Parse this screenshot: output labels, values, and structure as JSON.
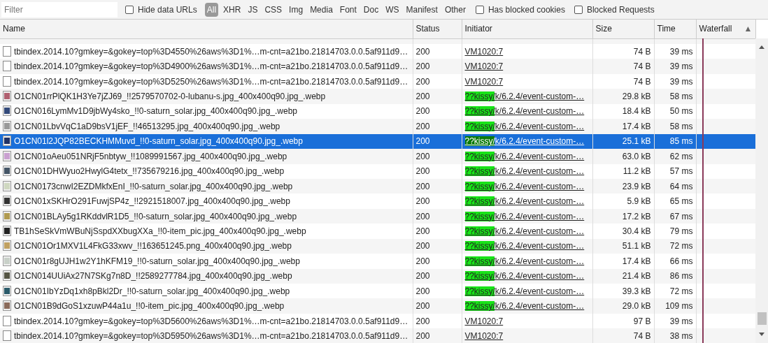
{
  "toolbar": {
    "filter": {
      "placeholder": "Filter"
    },
    "checkboxes_left": [
      {
        "label": "Hide data URLs",
        "checked": false
      }
    ],
    "types": [
      {
        "label": "All",
        "selected": true
      },
      {
        "label": "XHR",
        "selected": false
      },
      {
        "label": "JS",
        "selected": false
      },
      {
        "label": "CSS",
        "selected": false
      },
      {
        "label": "Img",
        "selected": false
      },
      {
        "label": "Media",
        "selected": false
      },
      {
        "label": "Font",
        "selected": false
      },
      {
        "label": "Doc",
        "selected": false
      },
      {
        "label": "WS",
        "selected": false
      },
      {
        "label": "Manifest",
        "selected": false
      },
      {
        "label": "Other",
        "selected": false
      }
    ],
    "checkboxes_right": [
      {
        "label": "Has blocked cookies",
        "checked": false
      },
      {
        "label": "Blocked Requests",
        "checked": false
      }
    ]
  },
  "table": {
    "columns": [
      "Name",
      "Status",
      "Initiator",
      "Size",
      "Time",
      "Waterfall"
    ],
    "sort_indicator": "▲",
    "rows": [
      {
        "kind": "doc",
        "name": "tbindex.2014.10?gmkey=&gokey=top%3D4550%26aws%3D1%…m-cnt=a21bo.21814703.0.0.5af911d9…",
        "status": "200",
        "initiator": "VM1020:7",
        "highlighted": false,
        "size": "74 B",
        "time": "39 ms",
        "selected": false
      },
      {
        "kind": "doc",
        "name": "tbindex.2014.10?gmkey=&gokey=top%3D4900%26aws%3D1%…m-cnt=a21bo.21814703.0.0.5af911d9…",
        "status": "200",
        "initiator": "VM1020:7",
        "highlighted": false,
        "size": "74 B",
        "time": "39 ms",
        "selected": false
      },
      {
        "kind": "doc",
        "name": "tbindex.2014.10?gmkey=&gokey=top%3D5250%26aws%3D1%…m-cnt=a21bo.21814703.0.0.5af911d9…",
        "status": "200",
        "initiator": "VM1020:7",
        "highlighted": false,
        "size": "74 B",
        "time": "39 ms",
        "selected": false
      },
      {
        "kind": "image",
        "name": "O1CN01rrPlQK1H3Ye7jZJ69_!!2579570702-0-lubanu-s.jpg_400x400q90.jpg_.webp",
        "status": "200",
        "initiator": "??kissy/k/6.2.4/event-custom-…",
        "highlighted": true,
        "size": "29.8 kB",
        "time": "58 ms",
        "selected": false
      },
      {
        "kind": "image",
        "name": "O1CN016LymMv1D9jbWy4sko_!!0-saturn_solar.jpg_400x400q90.jpg_.webp",
        "status": "200",
        "initiator": "??kissy/k/6.2.4/event-custom-…",
        "highlighted": true,
        "size": "18.4 kB",
        "time": "50 ms",
        "selected": false
      },
      {
        "kind": "image",
        "name": "O1CN01LbvVqC1aD9bsV1jEF_!!46513295.jpg_400x400q90.jpg_.webp",
        "status": "200",
        "initiator": "??kissy/k/6.2.4/event-custom-…",
        "highlighted": true,
        "size": "17.4 kB",
        "time": "58 ms",
        "selected": false
      },
      {
        "kind": "image",
        "name": "O1CN01l2JQP82BECKHMMuvd_!!0-saturn_solar.jpg_400x400q90.jpg_.webp",
        "status": "200",
        "initiator": "??kissy/k/6.2.4/event-custom-…",
        "highlighted": true,
        "size": "25.1 kB",
        "time": "85 ms",
        "selected": true
      },
      {
        "kind": "image",
        "name": "O1CN01oAeu051NRjF5nbtyw_!!1089991567.jpg_400x400q90.jpg_.webp",
        "status": "200",
        "initiator": "??kissy/k/6.2.4/event-custom-…",
        "highlighted": true,
        "size": "63.0 kB",
        "time": "62 ms",
        "selected": false
      },
      {
        "kind": "image",
        "name": "O1CN01DHWyuo2HwylG4tetx_!!735679216.jpg_400x400q90.jpg_.webp",
        "status": "200",
        "initiator": "??kissy/k/6.2.4/event-custom-…",
        "highlighted": true,
        "size": "11.2 kB",
        "time": "57 ms",
        "selected": false
      },
      {
        "kind": "image",
        "name": "O1CN0173cnwI2EZDMkfxEnI_!!0-saturn_solar.jpg_400x400q90.jpg_.webp",
        "status": "200",
        "initiator": "??kissy/k/6.2.4/event-custom-…",
        "highlighted": true,
        "size": "23.9 kB",
        "time": "64 ms",
        "selected": false
      },
      {
        "kind": "image",
        "name": "O1CN01xSKHrO291FuwjSP4z_!!2921518007.jpg_400x400q90.jpg_.webp",
        "status": "200",
        "initiator": "??kissy/k/6.2.4/event-custom-…",
        "highlighted": true,
        "size": "5.9 kB",
        "time": "65 ms",
        "selected": false
      },
      {
        "kind": "image",
        "name": "O1CN01BLAy5g1RKddvlR1D5_!!0-saturn_solar.jpg_400x400q90.jpg_.webp",
        "status": "200",
        "initiator": "??kissy/k/6.2.4/event-custom-…",
        "highlighted": true,
        "size": "17.2 kB",
        "time": "67 ms",
        "selected": false
      },
      {
        "kind": "image",
        "name": "TB1hSeSkVmWBuNjSspdXXbugXXa_!!0-item_pic.jpg_400x400q90.jpg_.webp",
        "status": "200",
        "initiator": "??kissy/k/6.2.4/event-custom-…",
        "highlighted": true,
        "size": "30.4 kB",
        "time": "79 ms",
        "selected": false
      },
      {
        "kind": "image",
        "name": "O1CN01Or1MXV1L4FkG33xwv_!!163651245.png_400x400q90.jpg_.webp",
        "status": "200",
        "initiator": "??kissy/k/6.2.4/event-custom-…",
        "highlighted": true,
        "size": "51.1 kB",
        "time": "72 ms",
        "selected": false
      },
      {
        "kind": "image",
        "name": "O1CN01r8gUJH1w2Y1hKFM19_!!0-saturn_solar.jpg_400x400q90.jpg_.webp",
        "status": "200",
        "initiator": "??kissy/k/6.2.4/event-custom-…",
        "highlighted": true,
        "size": "17.4 kB",
        "time": "66 ms",
        "selected": false
      },
      {
        "kind": "image",
        "name": "O1CN014UUiAx27N7SKg7n8D_!!2589277784.jpg_400x400q90.jpg_.webp",
        "status": "200",
        "initiator": "??kissy/k/6.2.4/event-custom-…",
        "highlighted": true,
        "size": "21.4 kB",
        "time": "86 ms",
        "selected": false
      },
      {
        "kind": "image",
        "name": "O1CN01IbYzDq1xh8pBkl2Dr_!!0-saturn_solar.jpg_400x400q90.jpg_.webp",
        "status": "200",
        "initiator": "??kissy/k/6.2.4/event-custom-…",
        "highlighted": true,
        "size": "39.3 kB",
        "time": "72 ms",
        "selected": false
      },
      {
        "kind": "image",
        "name": "O1CN01B9dGoS1xzuwP44a1u_!!0-item_pic.jpg_400x400q90.jpg_.webp",
        "status": "200",
        "initiator": "??kissy/k/6.2.4/event-custom-…",
        "highlighted": true,
        "size": "29.0 kB",
        "time": "109 ms",
        "selected": false
      },
      {
        "kind": "doc",
        "name": "tbindex.2014.10?gmkey=&gokey=top%3D5600%26aws%3D1%…m-cnt=a21bo.21814703.0.0.5af911d9…",
        "status": "200",
        "initiator": "VM1020:7",
        "highlighted": false,
        "size": "97 B",
        "time": "39 ms",
        "selected": false
      },
      {
        "kind": "doc",
        "name": "tbindex.2014.10?gmkey=&gokey=top%3D5950%26aws%3D1%…m-cnt=a21bo.21814703.0.0.5af911d9…",
        "status": "200",
        "initiator": "VM1020:7",
        "highlighted": false,
        "size": "74 B",
        "time": "38 ms",
        "selected": false
      }
    ]
  }
}
